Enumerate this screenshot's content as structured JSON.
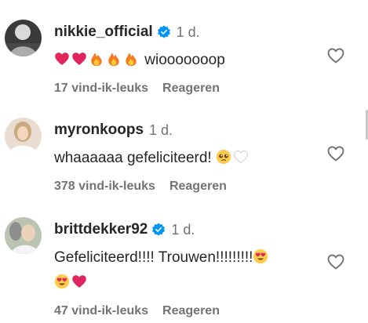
{
  "comments": [
    {
      "username": "nikkie_official",
      "verified": true,
      "time": "1 d.",
      "text": "wiooooooop",
      "emojis_before": [
        "red-heart",
        "red-heart",
        "fire",
        "fire",
        "fire"
      ],
      "likes": "17 vind-ik-leuks",
      "reply": "Reageren"
    },
    {
      "username": "myronkoops",
      "verified": false,
      "time": "1 d.",
      "text": "whaaaaaa gefeliciteerd!",
      "emojis_after": [
        "pleading-face",
        "white-heart"
      ],
      "likes": "378 vind-ik-leuks",
      "reply": "Reageren"
    },
    {
      "username": "brittdekker92",
      "verified": true,
      "time": "1 d.",
      "text": "Gefeliciteerd!!!! Trouwen!!!!!!!!!",
      "emojis_after": [
        "heart-eyes-face"
      ],
      "line2_emojis": [
        "heart-eyes-face",
        "red-heart"
      ],
      "likes": "47 vind-ik-leuks",
      "reply": "Reageren"
    }
  ],
  "colors": {
    "text": "#262626",
    "secondary": "#737373",
    "verified": "#0095f6",
    "heart_emoji": "#e0245e",
    "fire": "#f47b20"
  },
  "icons": {
    "like": "heart-outline-icon",
    "verified": "verified-badge-icon"
  }
}
